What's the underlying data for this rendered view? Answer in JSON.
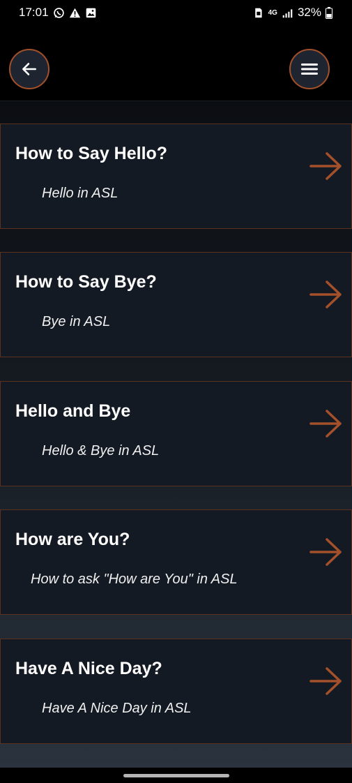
{
  "status_bar": {
    "time": "17:01",
    "network": "4G",
    "battery": "32%",
    "left_icons": [
      "whatsapp-icon",
      "warning-icon",
      "image-icon"
    ],
    "right_icons": [
      "sim-icon",
      "network-4g-icon",
      "signal-icon",
      "battery-icon"
    ]
  },
  "header": {
    "back_icon": "arrow-left-icon",
    "menu_icon": "hamburger-menu-icon"
  },
  "colors": {
    "accent": "#a4502a",
    "card_background": "#141a23",
    "page_background": "#000000"
  },
  "cards": [
    {
      "title": "How to Say Hello?",
      "subtitle": "Hello in ASL"
    },
    {
      "title": "How to Say Bye?",
      "subtitle": "Bye in ASL"
    },
    {
      "title": "Hello and Bye",
      "subtitle": "Hello & Bye in ASL"
    },
    {
      "title": "How are You?",
      "subtitle": "How to ask \"How are You\" in ASL"
    },
    {
      "title": "Have A Nice Day?",
      "subtitle": "Have A Nice Day in ASL"
    }
  ]
}
